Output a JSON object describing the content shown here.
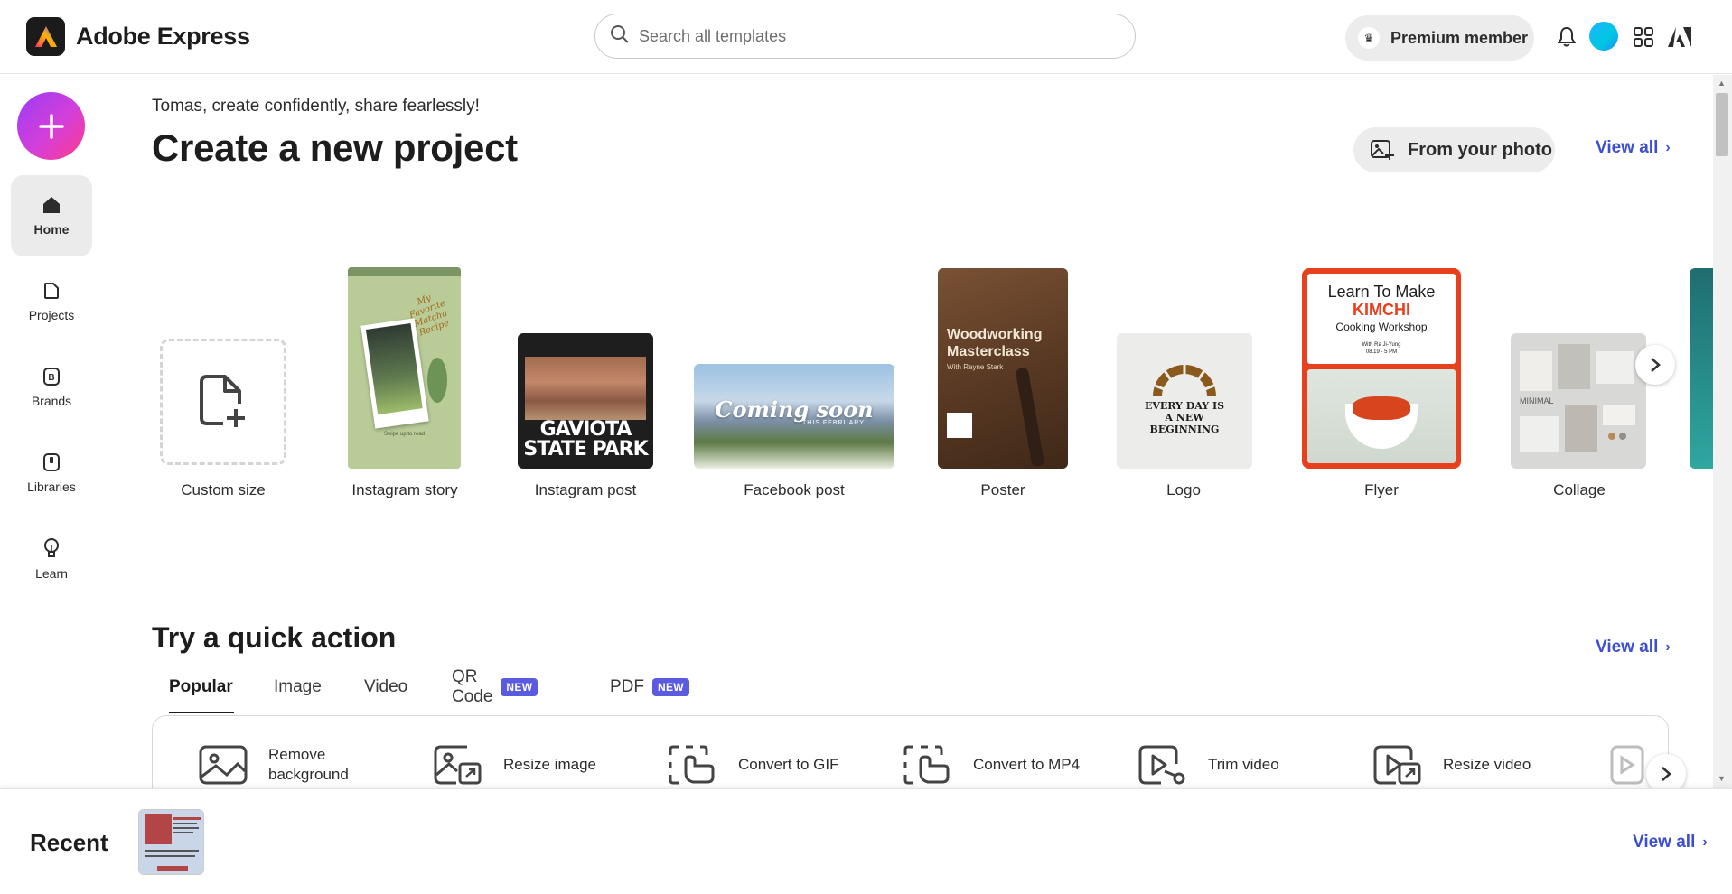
{
  "app": {
    "name": "Adobe Express"
  },
  "header": {
    "search_placeholder": "Search all templates",
    "premium_label": "Premium member",
    "icons": [
      "bell-icon",
      "avatar",
      "apps-grid-icon",
      "adobe-logo-icon"
    ]
  },
  "sidebar": {
    "items": [
      {
        "label": "Home",
        "icon": "home-icon",
        "active": true
      },
      {
        "label": "Projects",
        "icon": "projects-icon"
      },
      {
        "label": "Brands",
        "icon": "brands-icon"
      },
      {
        "label": "Libraries",
        "icon": "libraries-icon"
      },
      {
        "label": "Learn",
        "icon": "lightbulb-icon"
      }
    ]
  },
  "create": {
    "greeting": "Tomas, create confidently, share fearlessly!",
    "title": "Create a new project",
    "from_photo_label": "From your photo",
    "view_all": "View all",
    "cards": [
      {
        "label": "Custom size"
      },
      {
        "label": "Instagram story",
        "thumb_text": "My Favorite Matcha Recipe",
        "thumb_sub": "Swipe up to read"
      },
      {
        "label": "Instagram post",
        "thumb_text": "GAVIOTA STATE PARK"
      },
      {
        "label": "Facebook post",
        "thumb_text": "Coming soon",
        "thumb_sub": "THIS FEBRUARY"
      },
      {
        "label": "Poster",
        "thumb_text": "Woodworking Masterclass",
        "thumb_sub": "With Rayne Stark"
      },
      {
        "label": "Logo",
        "thumb_text": "EVERY DAY IS A NEW BEGINNING"
      },
      {
        "label": "Flyer",
        "thumb_text": "Learn To Make",
        "thumb_title": "KIMCHI",
        "thumb_sub": "Cooking Workshop",
        "thumb_meta": "With Ra Ji-Yung",
        "thumb_meta2": "08.19 - 5 PM"
      },
      {
        "label": "Collage",
        "thumb_text": "MINIMAL"
      }
    ]
  },
  "quick_actions": {
    "title": "Try a quick action",
    "view_all": "View all",
    "tabs": [
      {
        "label": "Popular",
        "active": true
      },
      {
        "label": "Image"
      },
      {
        "label": "Video"
      },
      {
        "label": "QR Code",
        "badge": "NEW"
      },
      {
        "label": "PDF",
        "badge": "NEW"
      }
    ],
    "items": [
      {
        "label": "Remove background",
        "icon": "remove-background-icon"
      },
      {
        "label": "Resize image",
        "icon": "resize-image-icon"
      },
      {
        "label": "Convert to GIF",
        "icon": "convert-gif-icon"
      },
      {
        "label": "Convert to MP4",
        "icon": "convert-mp4-icon"
      },
      {
        "label": "Trim video",
        "icon": "trim-video-icon"
      },
      {
        "label": "Resize video",
        "icon": "resize-video-icon"
      }
    ]
  },
  "recent": {
    "title": "Recent",
    "view_all": "View all"
  },
  "colors": {
    "accent_link": "#3d4fd1",
    "badge": "#5b5be0",
    "flyer_red": "#e8401c"
  }
}
